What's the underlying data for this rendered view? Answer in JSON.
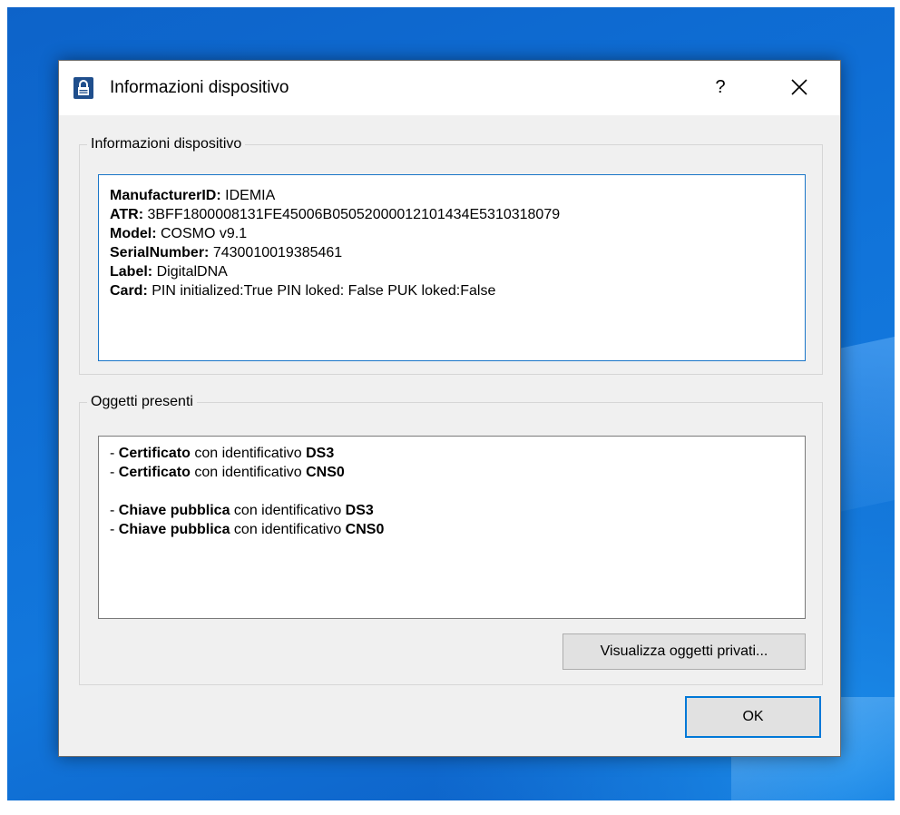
{
  "window": {
    "title": "Informazioni dispositivo",
    "help_label": "?",
    "close_label": "✕"
  },
  "device_info": {
    "group_title": "Informazioni dispositivo",
    "lines": [
      {
        "key": "ManufacturerID",
        "sep": ": ",
        "value": "IDEMIA"
      },
      {
        "key": "ATR",
        "sep": ": ",
        "value": "3BFF1800008131FE45006B05052000012101434E5310318079"
      },
      {
        "key": "Model",
        "sep": ": ",
        "value": "COSMO v9.1"
      },
      {
        "key": "SerialNumber",
        "sep": ": ",
        "value": "7430010019385461"
      },
      {
        "key": "Label",
        "sep": ": ",
        "value": "DigitalDNA"
      },
      {
        "key": "Card",
        "sep": ": ",
        "value": "PIN initialized:True PIN loked: False PUK loked:False"
      }
    ]
  },
  "objects": {
    "group_title": "Oggetti presenti",
    "lines": [
      {
        "prefix": "- ",
        "kind": "Certificato",
        "mid": " con identificativo ",
        "id": "DS3"
      },
      {
        "prefix": "- ",
        "kind": "Certificato",
        "mid": " con identificativo ",
        "id": "CNS0"
      },
      {
        "prefix": "- ",
        "kind": "Chiave pubblica",
        "mid": " con identificativo ",
        "id": "DS3"
      },
      {
        "prefix": "- ",
        "kind": "Chiave pubblica",
        "mid": " con identificativo ",
        "id": "CNS0"
      }
    ],
    "private_button": "Visualizza oggetti privati..."
  },
  "footer": {
    "ok_label": "OK"
  },
  "colors": {
    "accent": "#0078d7",
    "window_bg": "#f0f0f0",
    "titlebar_bg": "#ffffff",
    "icon_bg": "#1f4e8c"
  },
  "icons": {
    "title": "lock-icon",
    "help": "help-icon",
    "close": "close-icon"
  }
}
